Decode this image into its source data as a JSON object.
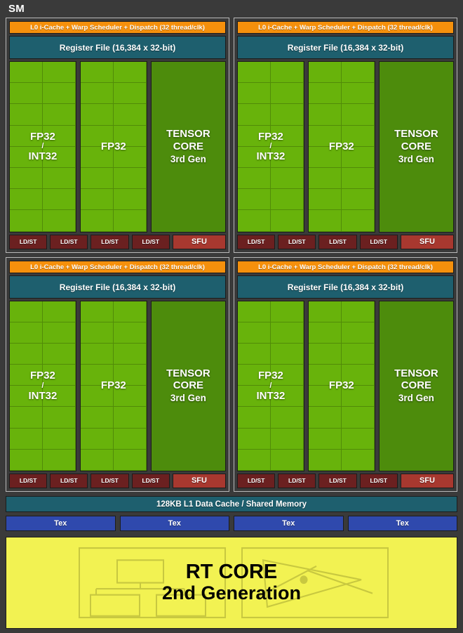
{
  "diagram": {
    "title": "SM",
    "colors": {
      "background": "#3a3a3a",
      "dispatch_orange": "#f5900c",
      "register_teal": "#1e5f6e",
      "fp32_green": "#68b30b",
      "tensor_green": "#4d8c0c",
      "ldst_maroon": "#6b2020",
      "sfu_red": "#a8382f",
      "tex_blue": "#2f49ad",
      "rtcore_yellow": "#f2f252",
      "panel_border": "#b9b9b9"
    }
  },
  "processing_blocks": [
    {
      "dispatch": "L0 i-Cache + Warp Scheduler + Dispatch (32 thread/clk)",
      "register_file": "Register File (16,384 x 32-bit)",
      "cores": [
        {
          "kind": "fp32_int32",
          "line1": "FP32",
          "slash": "/",
          "line2": "INT32",
          "cols": 2,
          "rows": 8
        },
        {
          "kind": "fp32",
          "line1": "FP32",
          "cols": 2,
          "rows": 8
        },
        {
          "kind": "tensor",
          "line1": "TENSOR",
          "line2": "CORE",
          "line3": "3rd Gen"
        }
      ],
      "ldst": [
        "LD/ST",
        "LD/ST",
        "LD/ST",
        "LD/ST"
      ],
      "sfu": "SFU"
    },
    {
      "dispatch": "L0 i-Cache + Warp Scheduler + Dispatch (32 thread/clk)",
      "register_file": "Register File (16,384 x 32-bit)",
      "cores": [
        {
          "kind": "fp32_int32",
          "line1": "FP32",
          "slash": "/",
          "line2": "INT32",
          "cols": 2,
          "rows": 8
        },
        {
          "kind": "fp32",
          "line1": "FP32",
          "cols": 2,
          "rows": 8
        },
        {
          "kind": "tensor",
          "line1": "TENSOR",
          "line2": "CORE",
          "line3": "3rd Gen"
        }
      ],
      "ldst": [
        "LD/ST",
        "LD/ST",
        "LD/ST",
        "LD/ST"
      ],
      "sfu": "SFU"
    },
    {
      "dispatch": "L0 i-Cache + Warp Scheduler + Dispatch (32 thread/clk)",
      "register_file": "Register File (16,384 x 32-bit)",
      "cores": [
        {
          "kind": "fp32_int32",
          "line1": "FP32",
          "slash": "/",
          "line2": "INT32",
          "cols": 2,
          "rows": 8
        },
        {
          "kind": "fp32",
          "line1": "FP32",
          "cols": 2,
          "rows": 8
        },
        {
          "kind": "tensor",
          "line1": "TENSOR",
          "line2": "CORE",
          "line3": "3rd Gen"
        }
      ],
      "ldst": [
        "LD/ST",
        "LD/ST",
        "LD/ST",
        "LD/ST"
      ],
      "sfu": "SFU"
    },
    {
      "dispatch": "L0 i-Cache + Warp Scheduler + Dispatch (32 thread/clk)",
      "register_file": "Register File (16,384 x 32-bit)",
      "cores": [
        {
          "kind": "fp32_int32",
          "line1": "FP32",
          "slash": "/",
          "line2": "INT32",
          "cols": 2,
          "rows": 8
        },
        {
          "kind": "fp32",
          "line1": "FP32",
          "cols": 2,
          "rows": 8
        },
        {
          "kind": "tensor",
          "line1": "TENSOR",
          "line2": "CORE",
          "line3": "3rd Gen"
        }
      ],
      "ldst": [
        "LD/ST",
        "LD/ST",
        "LD/ST",
        "LD/ST"
      ],
      "sfu": "SFU"
    }
  ],
  "l1_cache": {
    "label": "128KB L1 Data Cache / Shared Memory"
  },
  "tex_units": [
    {
      "label": "Tex"
    },
    {
      "label": "Tex"
    },
    {
      "label": "Tex"
    },
    {
      "label": "Tex"
    }
  ],
  "rt_core": {
    "line1": "RT CORE",
    "line2": "2nd Generation",
    "left_illustration": "bvh-tree-icon",
    "right_illustration": "ray-triangle-intersection-icon"
  }
}
